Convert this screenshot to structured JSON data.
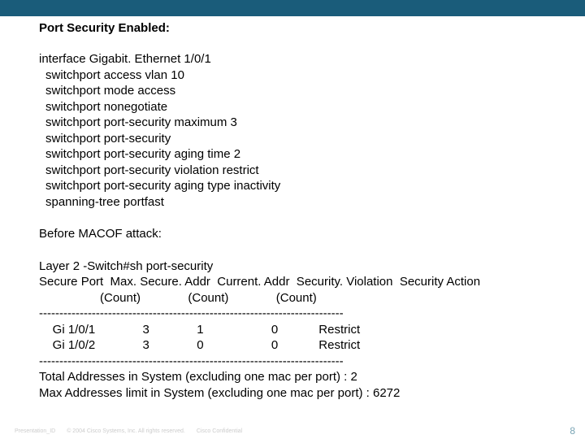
{
  "title": "Port Security Enabled:",
  "config": {
    "interface_line": "interface Gigabit. Ethernet 1/0/1",
    "lines": [
      "switchport access vlan 10",
      "switchport mode access",
      "switchport nonegotiate",
      "switchport port-security maximum 3",
      "switchport port-security",
      "switchport port-security aging time 2",
      "switchport port-security violation restrict",
      "switchport port-security aging type inactivity",
      "spanning-tree portfast"
    ]
  },
  "before_label": "Before MACOF attack:",
  "output": {
    "cmd": "Layer 2 -Switch#sh port-security",
    "header1": "Secure Port  Max. Secure. Addr  Current. Addr  Security. Violation  Security Action",
    "header2": "                  (Count)              (Count)              (Count)",
    "sep": "---------------------------------------------------------------------------",
    "row1": "    Gi 1/0/1              3              1                    0            Restrict",
    "row2": "    Gi 1/0/2              3              0                    0            Restrict",
    "total": "Total Addresses in System (excluding one mac per port)     : 2",
    "max": "Max Addresses limit in System (excluding one mac per port) : 6272"
  },
  "chart_data": {
    "type": "table",
    "title": "sh port-security",
    "columns": [
      "Secure Port",
      "Max.Secure.Addr (Count)",
      "Current.Addr (Count)",
      "Security.Violation (Count)",
      "Security Action"
    ],
    "rows": [
      {
        "port": "Gi 1/0/1",
        "max": 3,
        "current": 1,
        "violation": 0,
        "action": "Restrict"
      },
      {
        "port": "Gi 1/0/2",
        "max": 3,
        "current": 0,
        "violation": 0,
        "action": "Restrict"
      }
    ],
    "totals": {
      "total_addresses": 2,
      "max_addresses_limit": 6272
    }
  },
  "footer": {
    "pres_id": "Presentation_ID",
    "copyright": "© 2004 Cisco Systems, Inc. All rights reserved.",
    "conf": "Cisco Confidential",
    "page": "8"
  }
}
